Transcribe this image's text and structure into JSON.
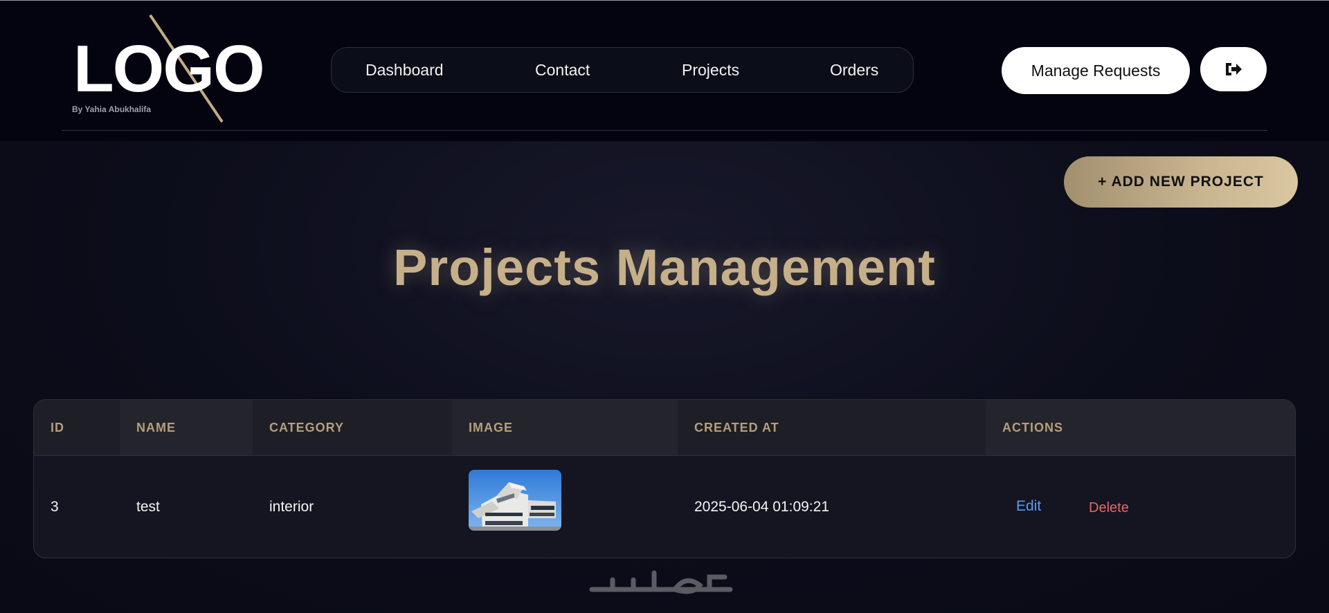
{
  "header": {
    "logo_text": "LOGO",
    "logo_subtitle": "By Yahia Abukhalifa",
    "nav": [
      "Dashboard",
      "Contact",
      "Projects",
      "Orders"
    ],
    "manage_label": "Manage Requests",
    "logout_icon": "sign-out-icon"
  },
  "main": {
    "add_label": "+ ADD NEW PROJECT",
    "title": "Projects Management"
  },
  "table": {
    "columns": [
      "ID",
      "NAME",
      "CATEGORY",
      "IMAGE",
      "CREATED AT",
      "ACTIONS"
    ],
    "rows": [
      {
        "id": "3",
        "name": "test",
        "category": "interior",
        "image_icon": "building-thumbnail",
        "created_at": "2025-06-04 01:09:21",
        "edit_label": "Edit",
        "delete_label": "Delete"
      }
    ]
  },
  "watermark": {
    "text": "خمسات"
  },
  "colors": {
    "accent_gold": "#c6b08a",
    "edit_blue": "#5b9bf0",
    "delete_red": "#e06a6a",
    "header_bg": "#03040f"
  }
}
